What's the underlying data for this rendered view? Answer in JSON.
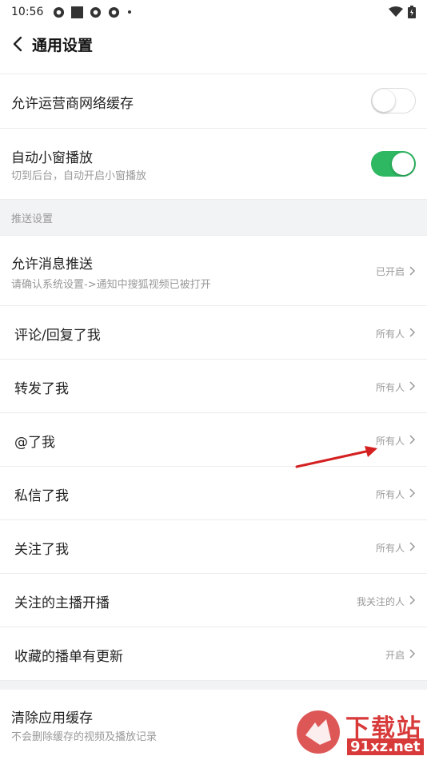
{
  "status_bar": {
    "time": "10:56"
  },
  "header": {
    "title": "通用设置"
  },
  "rows": {
    "carrier_cache": {
      "label": "允许运营商网络缓存",
      "toggle": "off"
    },
    "mini_window": {
      "label": "自动小窗播放",
      "sub": "切到后台，自动开启小窗播放",
      "toggle": "on"
    }
  },
  "push_section": {
    "header": "推送设置",
    "allow_push": {
      "label": "允许消息推送",
      "sub": "请确认系统设置->通知中搜狐视频已被打开",
      "value": "已开启"
    },
    "items": [
      {
        "label": "评论/回复了我",
        "value": "所有人"
      },
      {
        "label": "转发了我",
        "value": "所有人"
      },
      {
        "label": "@了我",
        "value": "所有人"
      },
      {
        "label": "私信了我",
        "value": "所有人"
      },
      {
        "label": "关注了我",
        "value": "所有人"
      },
      {
        "label": "关注的主播开播",
        "value": "我关注的人"
      },
      {
        "label": "收藏的播单有更新",
        "value": "开启"
      }
    ]
  },
  "clear_cache": {
    "label": "清除应用缓存",
    "sub": "不会删除缓存的视频及播放记录"
  },
  "watermark": {
    "logo_text": "下载站",
    "url_text": "91xz.net"
  },
  "colors": {
    "toggle_on": "#2db861",
    "section_bg": "#f2f3f5",
    "arrow": "#d42020"
  }
}
